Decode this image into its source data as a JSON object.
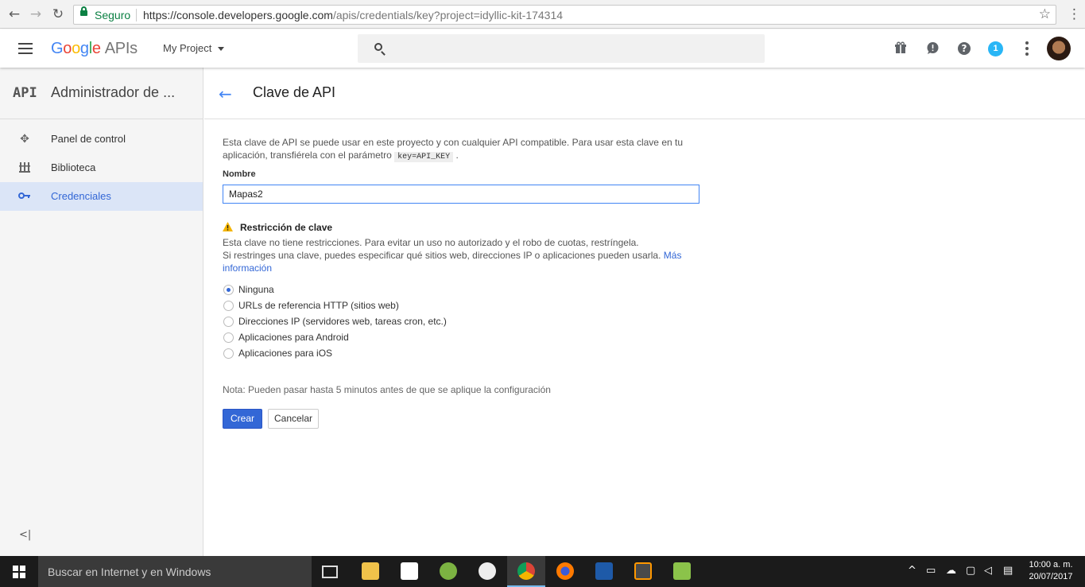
{
  "browser": {
    "secure_label": "Seguro",
    "url_host": "https://console.developers.google.com",
    "url_path": "/apis/credentials/key?project=idyllic-kit-174314"
  },
  "header": {
    "logo_letters": [
      "G",
      "o",
      "o",
      "g",
      "l",
      "e"
    ],
    "logo_suffix": "APIs",
    "project_name": "My Project",
    "notification_count": "1"
  },
  "sidebar": {
    "api_glyph": "API",
    "title": "Administrador de ...",
    "items": [
      {
        "label": "Panel de control",
        "icon": "dashboard-icon",
        "active": false
      },
      {
        "label": "Biblioteca",
        "icon": "library-icon",
        "active": false
      },
      {
        "label": "Credenciales",
        "icon": "key-icon",
        "active": true
      }
    ],
    "collapse_glyph": "<|"
  },
  "page": {
    "title": "Clave de API",
    "description_part1": "Esta clave de API se puede usar en este proyecto y con cualquier API compatible. Para usar esta clave en tu aplicación, transfiérela con el parámetro",
    "description_code": "key=API_KEY",
    "description_part2": ".",
    "name_label": "Nombre",
    "name_value": "Mapas2",
    "restriction_title": "Restricción de clave",
    "restriction_line1": "Esta clave no tiene restricciones. Para evitar un uso no autorizado y el robo de cuotas, restríngela.",
    "restriction_line2": "Si restringes una clave, puedes especificar qué sitios web, direcciones IP o aplicaciones pueden usarla.",
    "more_info_link": "Más información",
    "options": [
      {
        "label": "Ninguna",
        "selected": true
      },
      {
        "label": "URLs de referencia HTTP (sitios web)",
        "selected": false
      },
      {
        "label": "Direcciones IP (servidores web, tareas cron, etc.)",
        "selected": false
      },
      {
        "label": "Aplicaciones para Android",
        "selected": false
      },
      {
        "label": "Aplicaciones para iOS",
        "selected": false
      }
    ],
    "note": "Nota: Pueden pasar hasta 5 minutos antes de que se aplique la configuración",
    "create_button": "Crear",
    "cancel_button": "Cancelar"
  },
  "taskbar": {
    "search_placeholder": "Buscar en Internet y en Windows",
    "time": "10:00 a. m.",
    "date": "20/07/2017"
  },
  "colors": {
    "accent": "#3367d6",
    "secure_green": "#0b8043",
    "warning": "#f4b400"
  }
}
